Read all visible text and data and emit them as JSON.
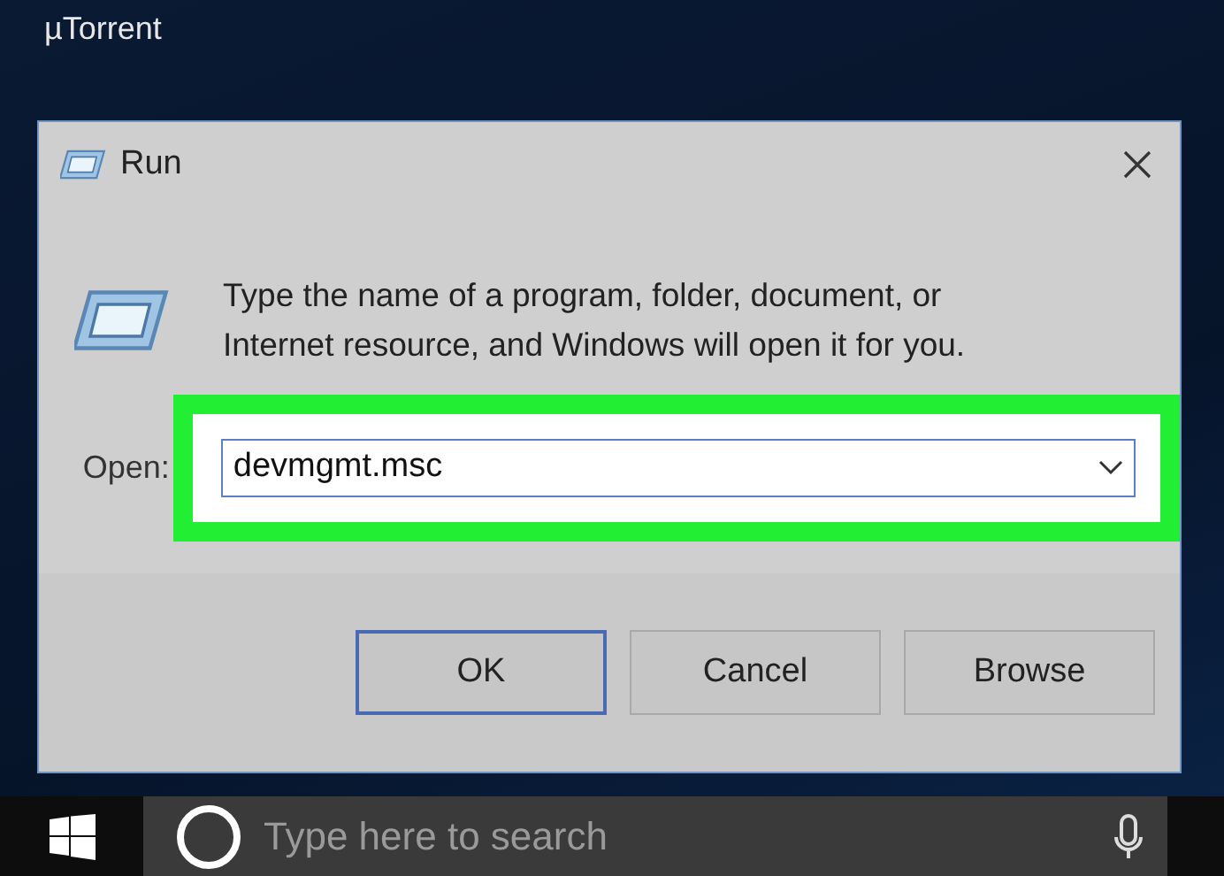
{
  "desktop_icons": [
    {
      "label": "µTorrent"
    }
  ],
  "dialog": {
    "title": "Run",
    "message": "Type the name of a program, folder, document, or Internet resource, and Windows will open it for you.",
    "open_label": "Open:",
    "open_value": "devmgmt.msc",
    "highlighted": true,
    "buttons": [
      {
        "label": "OK",
        "default": true
      },
      {
        "label": "Cancel",
        "default": false
      },
      {
        "label": "Browse",
        "default": false
      }
    ]
  },
  "taskbar": {
    "search": {
      "placeholder": "Type here to search"
    }
  }
}
